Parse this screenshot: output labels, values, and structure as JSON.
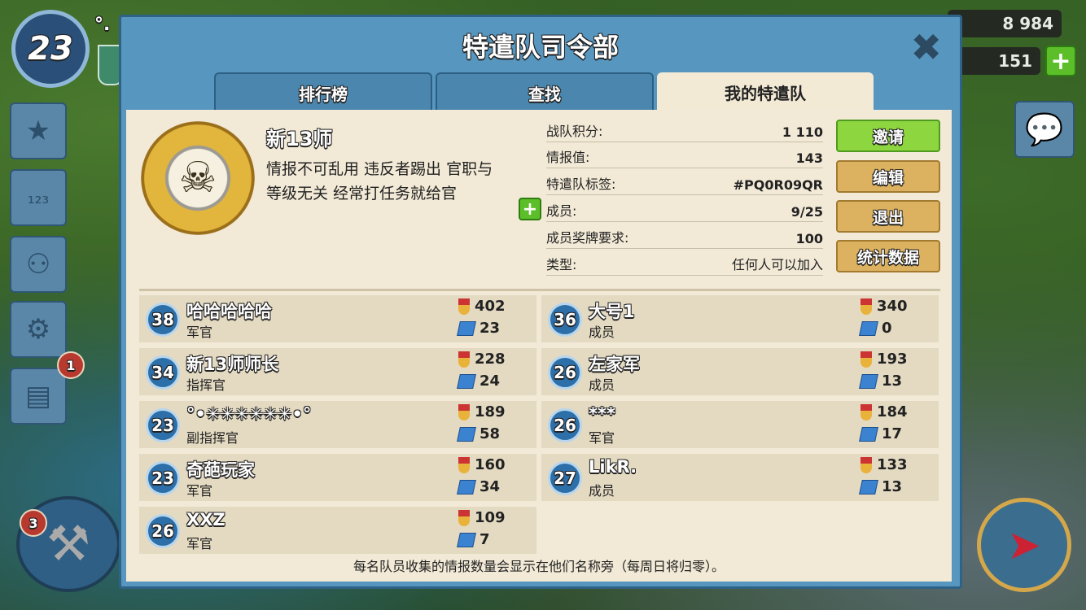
{
  "hud": {
    "player_level": "23",
    "player_name_partial": "°.",
    "resource_1_value": "8 984",
    "resource_2_value": "151",
    "plus_label": "+",
    "notification_count": "1",
    "builder_count": "3"
  },
  "dialog": {
    "title": "特遣队司令部",
    "close_label": "✖",
    "tabs": [
      {
        "label": "排行榜"
      },
      {
        "label": "查找"
      },
      {
        "label": "我的特遣队"
      }
    ]
  },
  "clan": {
    "name": "新13师",
    "description": "情报不可乱用 违反者踢出 官职与等级无关 经常打任务就给官",
    "info": [
      {
        "label": "战队积分:",
        "value": "1 110"
      },
      {
        "label": "情报值:",
        "value": "143"
      },
      {
        "label": "特遣队标签:",
        "value": "#PQ0R09QR"
      },
      {
        "label": "成员:",
        "value": "9/25"
      },
      {
        "label": "成员奖牌要求:",
        "value": "100"
      },
      {
        "label": "类型:",
        "value": "任何人可以加入"
      }
    ]
  },
  "actions": {
    "invite": "邀请",
    "edit": "编辑",
    "leave": "退出",
    "stats": "统计数据"
  },
  "members": [
    {
      "level": "38",
      "name": "哈哈哈哈哈",
      "role": "军官",
      "medals": "402",
      "intel": "23"
    },
    {
      "level": "36",
      "name": "大号1",
      "role": "成员",
      "medals": "340",
      "intel": "0"
    },
    {
      "level": "34",
      "name": "新13师师长",
      "role": "指挥官",
      "medals": "228",
      "intel": "24"
    },
    {
      "level": "26",
      "name": "左家军",
      "role": "成员",
      "medals": "193",
      "intel": "13"
    },
    {
      "level": "23",
      "name": "°•✳✳✳✳✳✳•°",
      "role": "副指挥官",
      "medals": "189",
      "intel": "58"
    },
    {
      "level": "26",
      "name": "***",
      "role": "军官",
      "medals": "184",
      "intel": "17"
    },
    {
      "level": "23",
      "name": "奇葩玩家",
      "role": "军官",
      "medals": "160",
      "intel": "34"
    },
    {
      "level": "27",
      "name": "LikR.",
      "role": "成员",
      "medals": "133",
      "intel": "13"
    },
    {
      "level": "26",
      "name": "XXZ",
      "role": "军官",
      "medals": "109",
      "intel": "7"
    }
  ],
  "footer_note": "每名队员收集的情报数量会显示在他们名称旁（每周日将归零）。",
  "icons": {
    "clan_badge": "skull-badge-icon",
    "chat": "chat-bubble-icon",
    "settings": "gears-icon",
    "ranking": "podium-icon",
    "stars": "stars-icon",
    "network": "network-icon",
    "news": "newspaper-icon",
    "builder": "hammer-icon",
    "map": "compass-icon"
  }
}
